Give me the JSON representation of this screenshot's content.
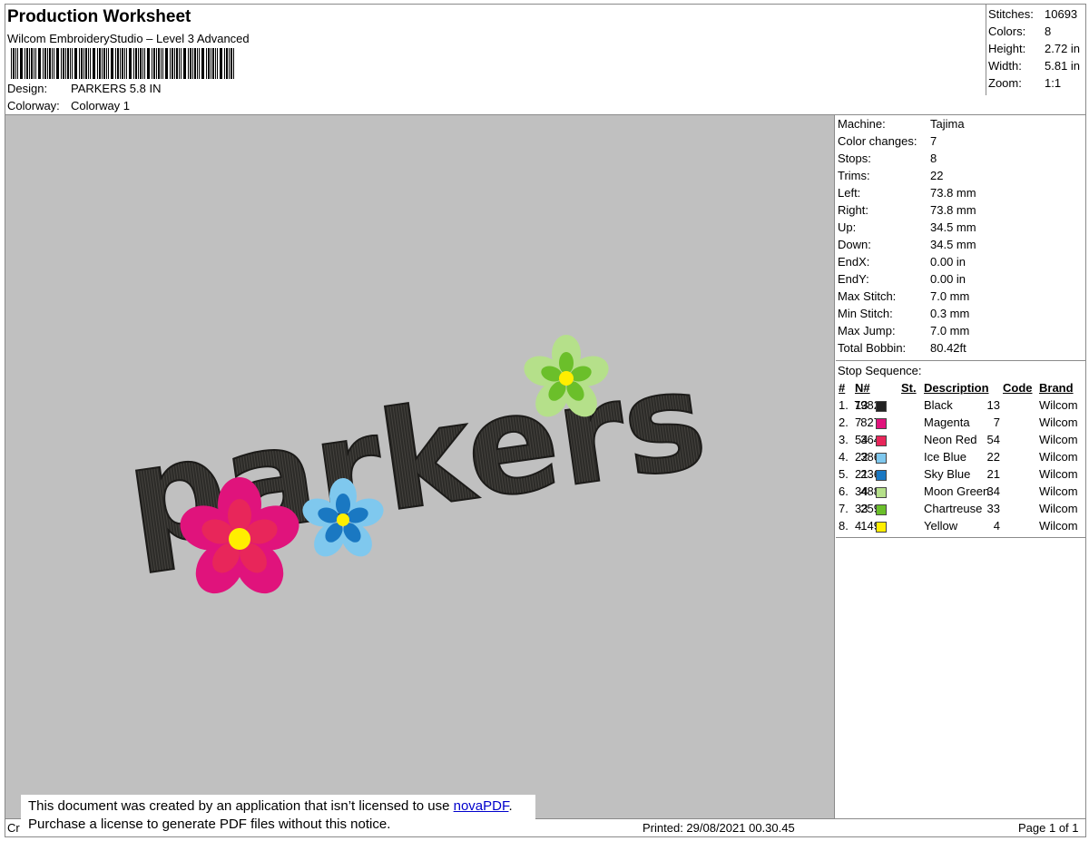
{
  "header": {
    "title": "Production Worksheet",
    "subtitle": "Wilcom EmbroideryStudio – Level 3 Advanced",
    "design_label": "Design:",
    "design_value": "PARKERS 5.8 IN",
    "colorway_label": "Colorway:",
    "colorway_value": "Colorway 1"
  },
  "summary": [
    {
      "label": "Stitches:",
      "value": "10693"
    },
    {
      "label": "Colors:",
      "value": "8"
    },
    {
      "label": "Height:",
      "value": "2.72 in"
    },
    {
      "label": "Width:",
      "value": "5.81 in"
    },
    {
      "label": "Zoom:",
      "value": "1:1"
    }
  ],
  "machine_info": [
    {
      "label": "Machine:",
      "value": "Tajima"
    },
    {
      "label": "Color changes:",
      "value": "7"
    },
    {
      "label": "Stops:",
      "value": "8"
    },
    {
      "label": "Trims:",
      "value": "22"
    },
    {
      "label": "Left:",
      "value": "73.8 mm"
    },
    {
      "label": "Right:",
      "value": "73.8 mm"
    },
    {
      "label": "Up:",
      "value": "34.5 mm"
    },
    {
      "label": "Down:",
      "value": "34.5 mm"
    },
    {
      "label": "EndX:",
      "value": "0.00 in"
    },
    {
      "label": "EndY:",
      "value": "0.00 in"
    },
    {
      "label": "Max Stitch:",
      "value": "7.0 mm"
    },
    {
      "label": "Min Stitch:",
      "value": "0.3 mm"
    },
    {
      "label": "Max Jump:",
      "value": "7.0 mm"
    },
    {
      "label": "Total Bobbin:",
      "value": "80.42ft"
    }
  ],
  "stop_sequence": {
    "title": "Stop Sequence:",
    "columns": {
      "num": "#",
      "n": "N#",
      "st": "St.",
      "desc": "Description",
      "code": "Code",
      "brand": "Brand"
    },
    "rows": [
      {
        "num": "1.",
        "n": "13",
        "color": "#222222",
        "st": "7982",
        "desc": "Black",
        "code": "13",
        "brand": "Wilcom"
      },
      {
        "num": "2.",
        "n": "7",
        "color": "#e0137c",
        "st": "827",
        "desc": "Magenta",
        "code": "7",
        "brand": "Wilcom"
      },
      {
        "num": "3.",
        "n": "54",
        "color": "#e8265a",
        "st": "364",
        "desc": "Neon Red",
        "code": "54",
        "brand": "Wilcom"
      },
      {
        "num": "4.",
        "n": "22",
        "color": "#7fc8ee",
        "st": "386",
        "desc": "Ice Blue",
        "code": "22",
        "brand": "Wilcom"
      },
      {
        "num": "5.",
        "n": "21",
        "color": "#1a78c2",
        "st": "236",
        "desc": "Sky Blue",
        "code": "21",
        "brand": "Wilcom"
      },
      {
        "num": "6.",
        "n": "34",
        "color": "#b5e08a",
        "st": "488",
        "desc": "Moon Green",
        "code": "34",
        "brand": "Wilcom"
      },
      {
        "num": "7.",
        "n": "33",
        "color": "#6bbf2a",
        "st": "259",
        "desc": "Chartreuse",
        "code": "33",
        "brand": "Wilcom"
      },
      {
        "num": "8.",
        "n": "4",
        "color": "#ffee00",
        "st": "149",
        "desc": "Yellow",
        "code": "4",
        "brand": "Wilcom"
      }
    ]
  },
  "design_preview": {
    "text": "parkers"
  },
  "footer": {
    "created_prefix": "Cr",
    "printed": "Printed: 29/08/2021 00.30.45",
    "page": "Page 1 of 1"
  },
  "notice": {
    "line1_prefix": "This document was created by an application that isn’t licensed to use ",
    "link": "novaPDF",
    "line1_suffix": ".",
    "line2": "Purchase a license to generate PDF files without this notice."
  }
}
